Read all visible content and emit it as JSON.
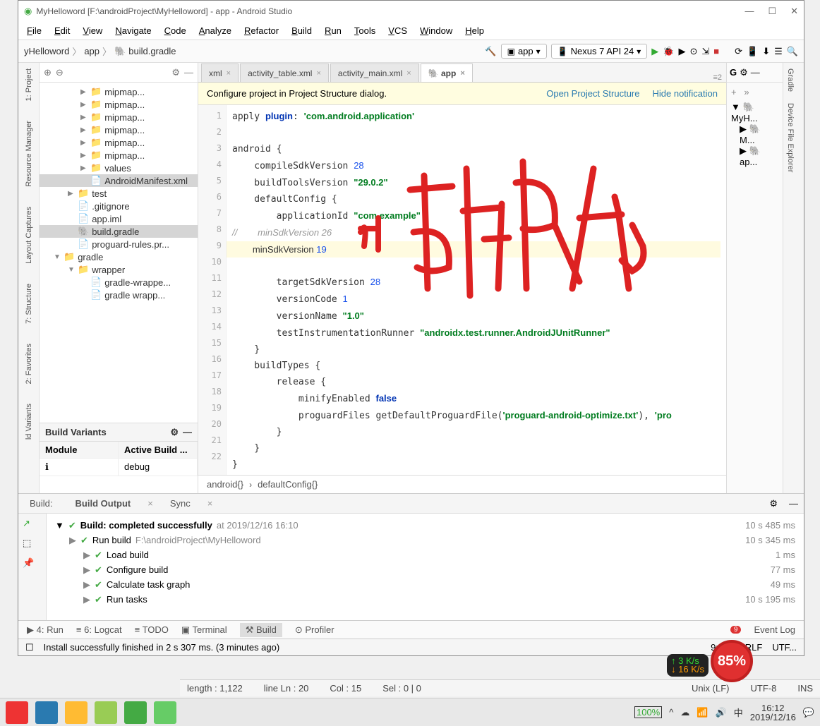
{
  "window": {
    "title": "MyHelloword [F:\\androidProject\\MyHelloword] - app - Android Studio"
  },
  "menus": [
    "File",
    "Edit",
    "View",
    "Navigate",
    "Code",
    "Analyze",
    "Refactor",
    "Build",
    "Run",
    "Tools",
    "VCS",
    "Window",
    "Help"
  ],
  "breadcrumb": [
    "yHelloword",
    "app",
    "build.gradle"
  ],
  "run_config": "app",
  "device": "Nexus 7 API 24",
  "left_tabs": [
    "1: Project",
    "Resource Manager",
    "Layout Captures",
    "7: Structure",
    "2: Favorites",
    "ld Variants"
  ],
  "right_tabs": [
    "Gradle",
    "Device File Explorer"
  ],
  "project_tree": [
    {
      "lvl": 2,
      "arrow": "▶",
      "icon": "📁",
      "name": "mipmap..."
    },
    {
      "lvl": 2,
      "arrow": "▶",
      "icon": "📁",
      "name": "mipmap..."
    },
    {
      "lvl": 2,
      "arrow": "▶",
      "icon": "📁",
      "name": "mipmap..."
    },
    {
      "lvl": 2,
      "arrow": "▶",
      "icon": "📁",
      "name": "mipmap..."
    },
    {
      "lvl": 2,
      "arrow": "▶",
      "icon": "📁",
      "name": "mipmap..."
    },
    {
      "lvl": 2,
      "arrow": "▶",
      "icon": "📁",
      "name": "mipmap..."
    },
    {
      "lvl": 2,
      "arrow": "▶",
      "icon": "📁",
      "name": "values"
    },
    {
      "lvl": 2,
      "arrow": "",
      "icon": "📄",
      "name": "AndroidManifest.xml",
      "sel": true
    },
    {
      "lvl": 1,
      "arrow": "▶",
      "icon": "📁",
      "name": "test"
    },
    {
      "lvl": 1,
      "arrow": "",
      "icon": "📄",
      "name": ".gitignore"
    },
    {
      "lvl": 1,
      "arrow": "",
      "icon": "📄",
      "name": "app.iml"
    },
    {
      "lvl": 1,
      "arrow": "",
      "icon": "🐘",
      "name": "build.gradle",
      "sel": true
    },
    {
      "lvl": 1,
      "arrow": "",
      "icon": "📄",
      "name": "proguard-rules.pr..."
    },
    {
      "lvl": 0,
      "arrow": "▼",
      "icon": "📁",
      "name": "gradle"
    },
    {
      "lvl": 1,
      "arrow": "▼",
      "icon": "📁",
      "name": "wrapper"
    },
    {
      "lvl": 2,
      "arrow": "",
      "icon": "📄",
      "name": "gradle-wrappe..."
    },
    {
      "lvl": 2,
      "arrow": "",
      "icon": "📄",
      "name": "gradle wrapp..."
    }
  ],
  "build_variants": {
    "title": "Build Variants",
    "columns": [
      "Module",
      "Active Build ..."
    ],
    "row": [
      "ℹ",
      "debug"
    ]
  },
  "editor_tabs": [
    {
      "label": "xml",
      "active": false
    },
    {
      "label": "activity_table.xml",
      "active": false
    },
    {
      "label": "activity_main.xml",
      "active": false
    },
    {
      "label": "app",
      "active": true
    }
  ],
  "notification": {
    "text": "Configure project in Project Structure dialog.",
    "link1": "Open Project Structure",
    "link2": "Hide notification"
  },
  "code_lines": [
    {
      "n": 1,
      "html": "apply <span class='kw'>plugin</span>: <span class='str'>'com.android.application'</span>"
    },
    {
      "n": 2,
      "html": ""
    },
    {
      "n": 3,
      "html": "android {"
    },
    {
      "n": 4,
      "html": "    compileSdkVersion <span class='num'>28</span>"
    },
    {
      "n": 5,
      "html": "    buildToolsVersion <span class='str'>\"29.0.2\"</span>"
    },
    {
      "n": 6,
      "html": "    defaultConfig {"
    },
    {
      "n": 7,
      "html": "        applicationId <span class='str'>\"com.example\"</span>"
    },
    {
      "n": 8,
      "html": "<span class='cmt'>//        minSdkVersion 26</span>"
    },
    {
      "n": 9,
      "html": "        minSdkVersion <span class='num'>19</span>",
      "hl": true
    },
    {
      "n": 10,
      "html": "        targetSdkVersion <span class='num'>28</span>"
    },
    {
      "n": 11,
      "html": "        versionCode <span class='num'>1</span>"
    },
    {
      "n": 12,
      "html": "        versionName <span class='str'>\"1.0\"</span>"
    },
    {
      "n": 13,
      "html": "        testInstrumentationRunner <span class='str'>\"androidx.test.runner.AndroidJUnitRunner\"</span>"
    },
    {
      "n": 14,
      "html": "    }"
    },
    {
      "n": 15,
      "html": "    buildTypes {"
    },
    {
      "n": 16,
      "html": "        release {"
    },
    {
      "n": 17,
      "html": "            minifyEnabled <span class='kw'>false</span>"
    },
    {
      "n": 18,
      "html": "            proguardFiles getDefaultProguardFile(<span class='str'>'proguard-android-optimize.txt'</span>), <span class='str'>'pro</span>"
    },
    {
      "n": 19,
      "html": "        }"
    },
    {
      "n": 20,
      "html": "    }"
    },
    {
      "n": 21,
      "html": "}"
    },
    {
      "n": 22,
      "html": ""
    }
  ],
  "editor_crumbs": [
    "android{}",
    "defaultConfig{}"
  ],
  "gradle_tree": [
    "MyH...",
    "M...",
    "ap..."
  ],
  "build_panel": {
    "tabs": [
      "Build:",
      "Build Output",
      "Sync"
    ],
    "rows": [
      {
        "indent": 0,
        "icon": "✔",
        "text": "Build: completed successfully",
        "sub": " at 2019/12/16 16:10",
        "time": "10 s 485 ms",
        "bold": true
      },
      {
        "indent": 1,
        "icon": "✔",
        "text": "Run build",
        "sub": " F:\\androidProject\\MyHelloword",
        "time": "10 s 345 ms"
      },
      {
        "indent": 2,
        "icon": "✔",
        "text": "Load build",
        "sub": "",
        "time": "1 ms"
      },
      {
        "indent": 2,
        "icon": "✔",
        "text": "Configure build",
        "sub": "",
        "time": "77 ms"
      },
      {
        "indent": 2,
        "icon": "✔",
        "text": "Calculate task graph",
        "sub": "",
        "time": "49 ms"
      },
      {
        "indent": 2,
        "icon": "✔",
        "text": "Run tasks",
        "sub": "",
        "time": "10 s 195 ms"
      }
    ]
  },
  "tool_windows": [
    "▶ 4: Run",
    "≡ 6: Logcat",
    "≡ TODO",
    "▣ Terminal",
    "⚒ Build",
    "⊙ Profiler"
  ],
  "tool_active": "⚒ Build",
  "event_log": "Event Log",
  "event_badge": "9",
  "status": {
    "msg": "Install successfully finished in 2 s 307 ms. (3 minutes ago)",
    "pos": "9:25",
    "eol": "CRLF",
    "enc": "UTF..."
  },
  "secondary_status": {
    "length": "length : 1,122",
    "line": "line Ln : 20",
    "col": "Col : 15",
    "sel": "Sel : 0 | 0",
    "eol": "Unix (LF)",
    "enc": "UTF-8",
    "ins": "INS"
  },
  "netspeed": {
    "up": "↑ 3  K/s",
    "down": "↓ 16 K/s"
  },
  "badge": "85%",
  "tray": {
    "battery": "100%",
    "ime": "中",
    "time": "16:12",
    "date": "2019/12/16"
  }
}
